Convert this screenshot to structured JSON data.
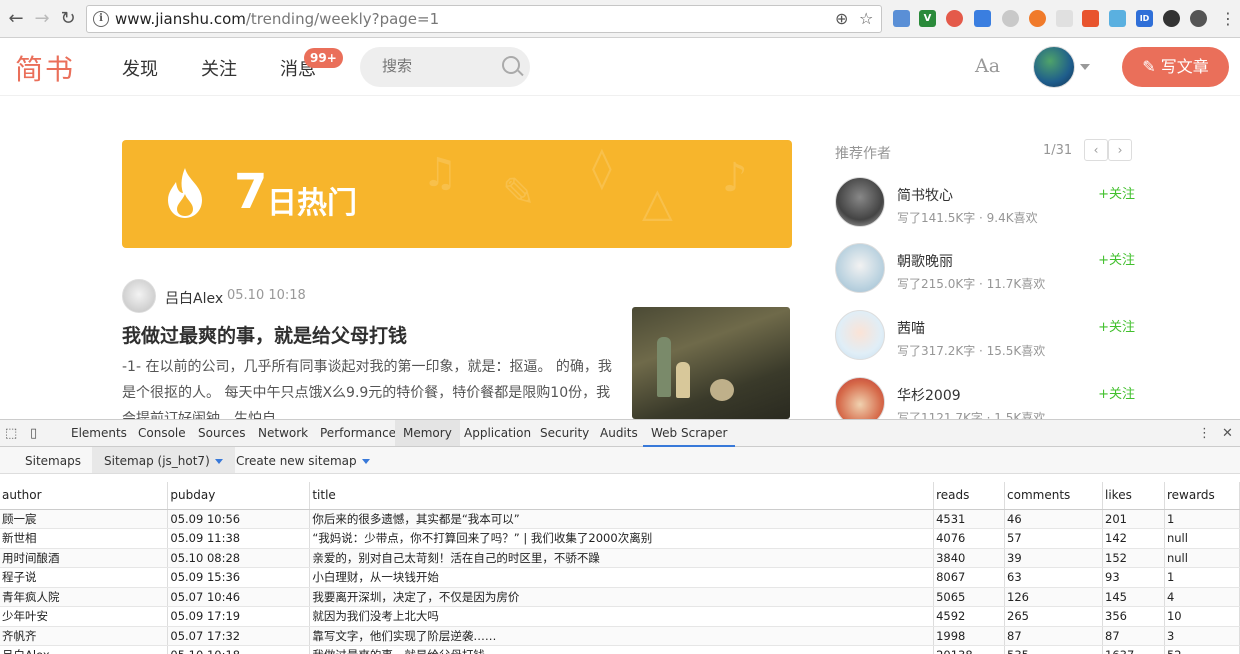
{
  "browser": {
    "url_host": "www.jianshu.com",
    "url_path": "/trending/weekly?page=1"
  },
  "header": {
    "logo": "简书",
    "nav": [
      "发现",
      "关注",
      "消息"
    ],
    "badge": "99+",
    "search_placeholder": "搜索",
    "font_toggle": "Aa",
    "write_label": "写文章",
    "accent": "#ea6f5a"
  },
  "banner": {
    "num": "7",
    "text": "日热门",
    "color": "#f7b52c"
  },
  "article": {
    "author": "吕白Alex",
    "time": "05.10 10:18",
    "title": "我做过最爽的事，就是给父母打钱",
    "abstract": "-1- 在以前的公司，几乎所有同事谈起对我的第一印象，就是：抠逼。 的确，我是个很抠的人。 每天中午只点饿X么9.9元的特价餐，特价餐都是限购10份，我会提前订好闹钟，生怕自"
  },
  "sidebar": {
    "title": "推荐作者",
    "page": "1/31",
    "prev": "‹",
    "next": "›",
    "follow": "+关注",
    "authors": [
      {
        "name": "简书牧心",
        "stat": "写了141.5K字 · 9.4K喜欢"
      },
      {
        "name": "朝歌晚丽",
        "stat": "写了215.0K字 · 11.7K喜欢"
      },
      {
        "name": "茜喵",
        "stat": "写了317.2K字 · 15.5K喜欢"
      },
      {
        "name": "华杉2009",
        "stat": "写了1121.7K字 · 1.5K喜欢"
      }
    ]
  },
  "devtools": {
    "tabs": [
      "Elements",
      "Console",
      "Sources",
      "Network",
      "Performance",
      "Memory",
      "Application",
      "Security",
      "Audits",
      "Web Scraper"
    ],
    "scraper_nav": [
      "Sitemaps",
      "Sitemap (js_hot7)",
      "Create new sitemap"
    ],
    "columns": [
      "author",
      "pubday",
      "title",
      "reads",
      "comments",
      "likes",
      "rewards"
    ],
    "rows": [
      [
        "顾一宸",
        "05.09 10:56",
        "你后来的很多遗憾，其实都是“我本可以”",
        "4531",
        "46",
        "201",
        "1"
      ],
      [
        "新世相",
        "05.09 11:38",
        "“我妈说：少带点，你不打算回来了吗？” | 我们收集了2000次离别",
        "4076",
        "57",
        "142",
        "null"
      ],
      [
        "用时间酿酒",
        "05.10 08:28",
        "亲爱的，别对自己太苛刻！活在自己的时区里，不骄不躁",
        "3840",
        "39",
        "152",
        "null"
      ],
      [
        "程子说",
        "05.09 15:36",
        "小白理财，从一块钱开始",
        "8067",
        "63",
        "93",
        "1"
      ],
      [
        "青年疯人院",
        "05.07 10:46",
        "我要离开深圳，决定了，不仅是因为房价",
        "5065",
        "126",
        "145",
        "4"
      ],
      [
        "少年叶安",
        "05.09 17:19",
        "就因为我们没考上北大吗",
        "4592",
        "265",
        "356",
        "10"
      ],
      [
        "齐帆齐",
        "05.07 17:32",
        "靠写文字，他们实现了阶层逆袭……",
        "1998",
        "87",
        "87",
        "3"
      ],
      [
        "吕白Alex",
        "05.10 10:18",
        "我做过最爽的事，就是给父母打钱",
        "20138",
        "535",
        "1637",
        "52"
      ]
    ]
  }
}
